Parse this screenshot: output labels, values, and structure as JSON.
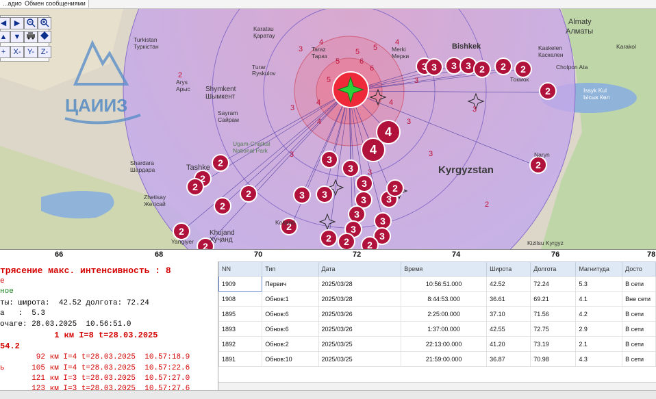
{
  "tabs": [
    "...адио",
    "Обмен сообщениями"
  ],
  "map": {
    "country_label": "Kyrgyzstan",
    "city_labels": [
      {
        "name": "Almaty\nАлматы"
      },
      {
        "name": "Bishkek"
      },
      {
        "name": "Taraz\nТараз"
      },
      {
        "name": "Shymkent\nШымкент"
      },
      {
        "name": "Turkistan\nТуркістан"
      },
      {
        "name": "Karatau\nҚаратау"
      },
      {
        "name": "Arys\nАрыс"
      },
      {
        "name": "Turar\nRyskulov\nТұрар\nРысқұлов"
      },
      {
        "name": "Sayram\nСайрам"
      },
      {
        "name": "Ugam-Chatkal\nNational Park"
      },
      {
        "name": "Tashkent"
      },
      {
        "name": "Shardara\nШардара"
      },
      {
        "name": "Zhetisay\nЖетісай"
      },
      {
        "name": "Khujand\nХуҷанд"
      },
      {
        "name": "Yangiyer"
      },
      {
        "name": "Kokand"
      },
      {
        "name": "Issyk Kul\nЫсык Көл"
      },
      {
        "name": "Tokmok\nТокмок"
      },
      {
        "name": "Cholpon Ata"
      },
      {
        "name": "Naryn"
      },
      {
        "name": "Kizilsu Kyrgyz"
      },
      {
        "name": "Merki\nМерки"
      },
      {
        "name": "Karakol"
      },
      {
        "name": "Kaskelen\nКаскелен"
      }
    ],
    "logo_text": "ЦАИИЗ",
    "epicenter_icon": "green-star-icon",
    "circle_labels": [
      "2",
      "3",
      "4",
      "5",
      "6"
    ]
  },
  "toolbar": {
    "buttons": [
      "◀",
      "▶",
      "🔍",
      "🔍",
      "▲",
      "▼",
      "🚗",
      "◆",
      "+",
      "X-",
      "Y-",
      "Z-"
    ]
  },
  "longitude_ticks": [
    "66",
    "68",
    "70",
    "72",
    "74",
    "76",
    "78"
  ],
  "left_panel": {
    "lines": [
      {
        "text": "трясение макс. интенсивность : 8",
        "color": "#d40000",
        "bold": true
      },
      {
        "text": "е",
        "color": "#d40000"
      },
      {
        "text": "ное",
        "color": "#1c8a1c"
      },
      {
        "text": "ты: широта:  42.52 долгота: 72.24",
        "color": "#000"
      },
      {
        "text": "а   :  5.3",
        "color": "#000"
      },
      {
        "text": "очаге: 28.03.2025  10.56:51.0",
        "color": "#000"
      },
      {
        "text": "           1 км I=8 t=28.03.2025",
        "color": "#d40000",
        "bold": true
      },
      {
        "text": "54.2",
        "color": "#d40000",
        "bold": true
      },
      {
        "text": "        92 км I=4 t=28.03.2025  10.57:18.9",
        "color": "#d40000"
      },
      {
        "text": "ь      105 км I=4 t=28.03.2025  10.57:22.6",
        "color": "#d40000"
      },
      {
        "text": "       121 км I=3 t=28.03.2025  10.57:27.0",
        "color": "#d40000"
      },
      {
        "text": "       123 км I=3 t=28.03.2025  10.57:27.6",
        "color": "#d40000"
      }
    ]
  },
  "table": {
    "headers": [
      "NN",
      "Тип",
      "Дата",
      "Время",
      "Широта",
      "Долгота",
      "Магнитуда",
      "Досто"
    ],
    "rows": [
      [
        "1909",
        "Первич",
        "2025/03/28",
        "10:56:51.000",
        "42.52",
        "72.24",
        "5.3",
        "В сети"
      ],
      [
        "1908",
        "Обнов:1",
        "2025/03/28",
        "8:44:53.000",
        "36.61",
        "69.21",
        "4.1",
        "Вне сети"
      ],
      [
        "1895",
        "Обнов:6",
        "2025/03/26",
        "2:25:00.000",
        "37.10",
        "71.56",
        "4.2",
        "В сети"
      ],
      [
        "1893",
        "Обнов:6",
        "2025/03/26",
        "1:37:00.000",
        "42.55",
        "72.75",
        "2.9",
        "В сети"
      ],
      [
        "1892",
        "Обнов:2",
        "2025/03/25",
        "22:13:00.000",
        "41.20",
        "73.19",
        "2.1",
        "В сети"
      ],
      [
        "1891",
        "Обнов:10",
        "2025/03/25",
        "21:59:00.000",
        "36.87",
        "70.98",
        "4.3",
        "В сети"
      ]
    ]
  },
  "colors": {
    "intensity_circle": "#e8303c",
    "marker_fill": "#b0123c",
    "zone_fill": "#c9a8e8",
    "header_bg": "#dfe9f5"
  }
}
